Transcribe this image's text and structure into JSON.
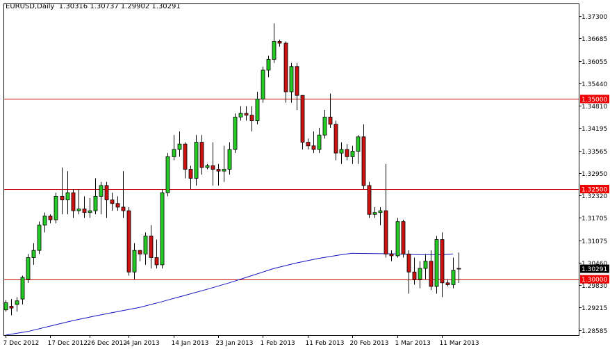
{
  "title": {
    "symbol": "EURUSD,Daily",
    "ohlc": "1.30316 1.30737 1.29902 1.30291"
  },
  "colors": {
    "background": "#ffffff",
    "frame": "#000000",
    "bull_body": "#22cc22",
    "bear_body": "#cc1111",
    "wick": "#000000",
    "ma_line": "#1010c0",
    "hline": "#cc0000",
    "current_price_tag": "#000000",
    "level_tag": "#ee0000"
  },
  "chart_data": {
    "type": "candlestick",
    "symbol": "EURUSD",
    "timeframe": "Daily",
    "ylim": [
      1.2845,
      1.3765
    ],
    "y_ticks": [
      "1.37300",
      "1.36685",
      "1.36055",
      "1.35440",
      "1.34810",
      "1.34195",
      "1.33565",
      "1.32950",
      "1.32320",
      "1.31705",
      "1.31075",
      "1.30460",
      "1.29830",
      "1.29215",
      "1.28585"
    ],
    "x_labels": [
      "7 Dec 2012",
      "17 Dec 2012",
      "26 Dec 2012",
      "4 Jan 2013",
      "14 Jan 2013",
      "23 Jan 2013",
      "1 Feb 2013",
      "11 Feb 2013",
      "20 Feb 2013",
      "1 Mar 2013",
      "11 Mar 2013"
    ],
    "x_label_index": [
      0,
      8,
      15,
      22,
      30,
      38,
      46,
      54,
      62,
      70,
      78
    ],
    "horizontal_lines": [
      {
        "price": 1.35,
        "label": "1.35000"
      },
      {
        "price": 1.325,
        "label": "1.32500"
      },
      {
        "price": 1.3,
        "label": "1.30000"
      }
    ],
    "current_price": {
      "price": 1.30291,
      "label": "1.30291"
    },
    "moving_average": [
      [
        0,
        1.2845
      ],
      [
        4,
        1.2855
      ],
      [
        8,
        1.287
      ],
      [
        12,
        1.2885
      ],
      [
        16,
        1.2898
      ],
      [
        20,
        1.291
      ],
      [
        24,
        1.2922
      ],
      [
        28,
        1.2938
      ],
      [
        32,
        1.2955
      ],
      [
        36,
        1.2972
      ],
      [
        40,
        1.299
      ],
      [
        44,
        1.301
      ],
      [
        48,
        1.303
      ],
      [
        52,
        1.3045
      ],
      [
        56,
        1.3058
      ],
      [
        60,
        1.3068
      ],
      [
        62,
        1.3072
      ],
      [
        66,
        1.3071
      ],
      [
        70,
        1.307
      ],
      [
        74,
        1.3068
      ],
      [
        78,
        1.3068
      ],
      [
        80,
        1.307
      ]
    ],
    "candles": [
      [
        1.2915,
        1.2942,
        1.291,
        1.2935
      ],
      [
        1.2925,
        1.2945,
        1.29,
        1.292
      ],
      [
        1.293,
        1.295,
        1.291,
        1.294
      ],
      [
        1.2945,
        1.301,
        1.293,
        1.3005
      ],
      [
        1.3,
        1.307,
        1.299,
        1.306
      ],
      [
        1.306,
        1.31,
        1.304,
        1.308
      ],
      [
        1.308,
        1.316,
        1.307,
        1.315
      ],
      [
        1.315,
        1.3185,
        1.313,
        1.3175
      ],
      [
        1.3175,
        1.318,
        1.3155,
        1.3165
      ],
      [
        1.3165,
        1.324,
        1.3155,
        1.323
      ],
      [
        1.323,
        1.331,
        1.318,
        1.322
      ],
      [
        1.322,
        1.33,
        1.318,
        1.324
      ],
      [
        1.324,
        1.325,
        1.317,
        1.319
      ],
      [
        1.319,
        1.325,
        1.318,
        1.3195
      ],
      [
        1.3195,
        1.323,
        1.317,
        1.3185
      ],
      [
        1.3185,
        1.3225,
        1.317,
        1.319
      ],
      [
        1.319,
        1.328,
        1.318,
        1.323
      ],
      [
        1.323,
        1.327,
        1.318,
        1.326
      ],
      [
        1.326,
        1.327,
        1.317,
        1.322
      ],
      [
        1.322,
        1.324,
        1.319,
        1.321
      ],
      [
        1.321,
        1.323,
        1.319,
        1.32
      ],
      [
        1.32,
        1.33,
        1.317,
        1.319
      ],
      [
        1.319,
        1.32,
        1.301,
        1.302
      ],
      [
        1.302,
        1.31,
        1.3,
        1.308
      ],
      [
        1.308,
        1.307,
        1.305,
        1.307
      ],
      [
        1.307,
        1.313,
        1.304,
        1.312
      ],
      [
        1.312,
        1.315,
        1.303,
        1.306
      ],
      [
        1.306,
        1.311,
        1.303,
        1.304
      ],
      [
        1.304,
        1.325,
        1.303,
        1.324
      ],
      [
        1.324,
        1.335,
        1.323,
        1.334
      ],
      [
        1.334,
        1.34,
        1.333,
        1.336
      ],
      [
        1.336,
        1.341,
        1.334,
        1.3375
      ],
      [
        1.3375,
        1.338,
        1.328,
        1.3305
      ],
      [
        1.3305,
        1.3315,
        1.325,
        1.328
      ],
      [
        1.328,
        1.34,
        1.326,
        1.338
      ],
      [
        1.338,
        1.34,
        1.329,
        1.331
      ],
      [
        1.331,
        1.332,
        1.3305,
        1.3315
      ],
      [
        1.3315,
        1.338,
        1.326,
        1.3305
      ],
      [
        1.3305,
        1.332,
        1.326,
        1.33
      ],
      [
        1.33,
        1.337,
        1.327,
        1.3305
      ],
      [
        1.3305,
        1.338,
        1.329,
        1.336
      ],
      [
        1.336,
        1.346,
        1.335,
        1.345
      ],
      [
        1.345,
        1.348,
        1.344,
        1.346
      ],
      [
        1.346,
        1.348,
        1.344,
        1.3455
      ],
      [
        1.3455,
        1.348,
        1.341,
        1.344
      ],
      [
        1.344,
        1.352,
        1.343,
        1.35
      ],
      [
        1.35,
        1.359,
        1.349,
        1.358
      ],
      [
        1.358,
        1.362,
        1.356,
        1.361
      ],
      [
        1.361,
        1.371,
        1.36,
        1.366
      ],
      [
        1.366,
        1.3665,
        1.3645,
        1.3655
      ],
      [
        1.3655,
        1.366,
        1.349,
        1.352
      ],
      [
        1.352,
        1.36,
        1.349,
        1.359
      ],
      [
        1.359,
        1.36,
        1.347,
        1.351
      ],
      [
        1.351,
        1.351,
        1.336,
        1.338
      ],
      [
        1.338,
        1.339,
        1.336,
        1.337
      ],
      [
        1.337,
        1.341,
        1.335,
        1.336
      ],
      [
        1.336,
        1.342,
        1.335,
        1.34
      ],
      [
        1.34,
        1.347,
        1.339,
        1.345
      ],
      [
        1.345,
        1.3515,
        1.342,
        1.343
      ],
      [
        1.343,
        1.344,
        1.333,
        1.335
      ],
      [
        1.335,
        1.338,
        1.332,
        1.336
      ],
      [
        1.336,
        1.3375,
        1.333,
        1.334
      ],
      [
        1.334,
        1.337,
        1.332,
        1.3355
      ],
      [
        1.3355,
        1.34,
        1.332,
        1.3395
      ],
      [
        1.3395,
        1.343,
        1.325,
        1.326
      ],
      [
        1.326,
        1.327,
        1.317,
        1.318
      ],
      [
        1.318,
        1.32,
        1.317,
        1.3185
      ],
      [
        1.3185,
        1.32,
        1.315,
        1.319
      ],
      [
        1.319,
        1.332,
        1.306,
        1.307
      ],
      [
        1.307,
        1.308,
        1.305,
        1.3065
      ],
      [
        1.3065,
        1.317,
        1.306,
        1.316
      ],
      [
        1.316,
        1.3165,
        1.306,
        1.307
      ],
      [
        1.307,
        1.308,
        1.296,
        1.302
      ],
      [
        1.302,
        1.306,
        1.2985,
        1.3
      ],
      [
        1.3,
        1.305,
        1.2975,
        1.303
      ],
      [
        1.303,
        1.307,
        1.3,
        1.305
      ],
      [
        1.305,
        1.308,
        1.297,
        1.298
      ],
      [
        1.298,
        1.312,
        1.296,
        1.311
      ],
      [
        1.311,
        1.313,
        1.295,
        1.299
      ],
      [
        1.299,
        1.3,
        1.298,
        1.2985
      ],
      [
        1.2985,
        1.306,
        1.2975,
        1.3025
      ],
      [
        1.303,
        1.3074,
        1.299,
        1.3029
      ]
    ]
  }
}
